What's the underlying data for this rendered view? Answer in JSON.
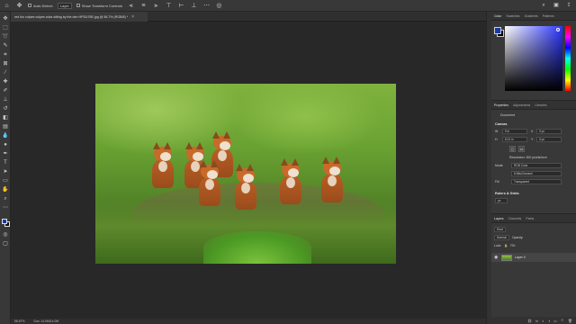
{
  "options_bar": {
    "auto_select_label": "Auto-Select:",
    "auto_select_value": "Layer",
    "show_transform_label": "Show Transform Controls"
  },
  "document": {
    "tab_title": "red fox vulpes vulpes cubs sitting by the den HPSU76E.jpg @ 56.7% (RGB/8) *",
    "tab_close": "×"
  },
  "status_bar": {
    "zoom": "56.67%",
    "doc_info": "Doc: 14.0M/14.0M"
  },
  "color_panel": {
    "tabs": [
      "Color",
      "Swatches",
      "Gradients",
      "Patterns"
    ],
    "foreground": "#1a3aa8",
    "background": "#000000"
  },
  "properties": {
    "tabs": [
      "Properties",
      "Adjustments",
      "Libraries"
    ],
    "type_label": "Document",
    "canvas_label": "Canvas",
    "w_value": "9 in",
    "h_value": "6.01 in",
    "x_value": "0 px",
    "y_value": "0 px",
    "resolution": "Resolution: 300 pixels/inch",
    "mode_label": "Mode",
    "mode_value": "RGB Color",
    "bits_value": "8 Bits/Channel",
    "fill_label": "Fill",
    "fill_value": "Transparent",
    "rulers_label": "Rulers & Grids",
    "units_value": "px"
  },
  "layers": {
    "tabs": [
      "Layers",
      "Channels",
      "Paths"
    ],
    "kind_label": "Kind",
    "blend_value": "Normal",
    "opacity_label": "Opacity:",
    "lock_label": "Lock:",
    "fill_label": "Fill:",
    "layer_name": "Layer 0"
  }
}
